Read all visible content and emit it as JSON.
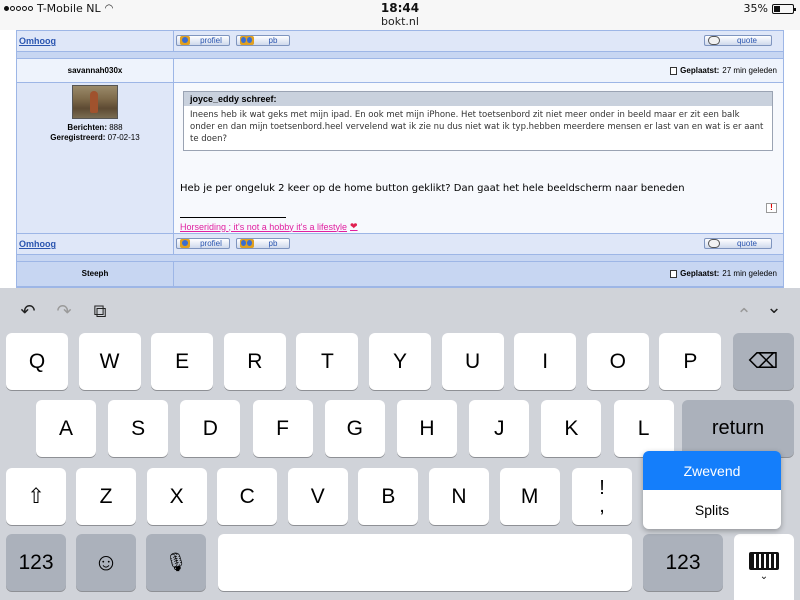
{
  "status_bar": {
    "carrier": "T-Mobile NL",
    "time": "18:44",
    "battery": "35%",
    "battery_level": 0.35,
    "url": "bokt.nl"
  },
  "forum": {
    "up_link": "Omhoog",
    "profile_button": "profiel",
    "pm_button": "pb",
    "quote_button": "quote",
    "posted_label": "Geplaatst:",
    "posts": [
      {
        "username": "savannah030x",
        "posts_label": "Berichten:",
        "posts_count": "888",
        "registered_label": "Geregistreerd:",
        "registered": "07-02-13",
        "posted_time": "27 min geleden",
        "quote_author": "joyce_eddy schreef:",
        "quote_text": "Ineens heb ik wat geks met mijn ipad. En ook met mijn iPhone. Het toetsenbord zit niet meer onder in beeld maar er zit een balk onder en dan mijn toetsenbord.heel vervelend wat ik zie nu dus niet wat ik typ.hebben meerdere mensen er last van en wat is er aant te doen?",
        "body": "Heb je per ongeluk 2 keer op de home button geklikt? Dan gaat het hele beeldscherm naar beneden",
        "signature": "Horseriding ; it's not a hobby it's a lifestyle",
        "heart": "❤"
      },
      {
        "username": "Steeph",
        "posted_time": "21 min geleden"
      }
    ]
  },
  "keyboard": {
    "toolbar": {
      "undo": "↶",
      "redo": "↷",
      "paste": "⧉",
      "up": "⌃",
      "down": "⌄"
    },
    "row1": [
      "Q",
      "W",
      "E",
      "R",
      "T",
      "Y",
      "U",
      "I",
      "O",
      "P"
    ],
    "backspace": "⌫",
    "row2": [
      "A",
      "S",
      "D",
      "F",
      "G",
      "H",
      "J",
      "K",
      "L"
    ],
    "return": "return",
    "shift": "⇧",
    "row3": [
      "Z",
      "X",
      "C",
      "V",
      "B",
      "N",
      "M"
    ],
    "punct_top": "!",
    "punct_bottom": ",",
    "numbers": "123",
    "emoji": "☺",
    "mic": "🎙",
    "space": "",
    "popover": {
      "floating": "Zwevend",
      "split": "Splits"
    },
    "accent_color": "#147efb"
  }
}
